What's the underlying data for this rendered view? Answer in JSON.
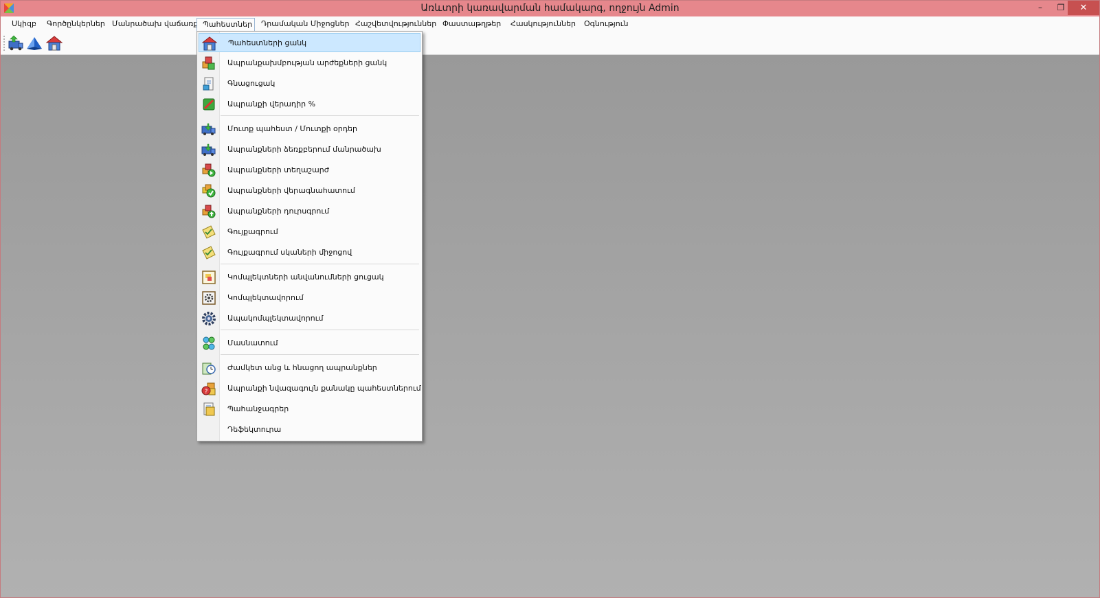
{
  "window": {
    "title": "Առևտրի կառավարման համակարգ, ողջույն Admin",
    "controls": {
      "minimize": "–",
      "restore": "❐",
      "close": "✕"
    }
  },
  "menubar": {
    "items": [
      "Սկիզբ",
      "Գործընկերներ",
      "Մանրածախ վաճառք",
      "Պահեստներ",
      "Դրամական Միջոցներ",
      "Հաշվետվություններ",
      "Փաստաթղթեր",
      "Հասկություններ",
      "Օգնություն"
    ],
    "active_index": 3
  },
  "toolbar": {
    "buttons": [
      "truck-upload-icon",
      "blue-pyramid-icon",
      "warehouse-house-icon"
    ]
  },
  "dropdown": {
    "items": [
      {
        "label": "Պահեստների ցանկ",
        "icon": "warehouse-house-icon",
        "highlighted": true
      },
      {
        "label": "Ապրանքախմբության արժեքների ցանկ",
        "icon": "product-boxes-icon"
      },
      {
        "label": "Գնացուցակ",
        "icon": "price-list-icon"
      },
      {
        "label": "Ապրանքի վերադիր %",
        "icon": "markup-percent-icon"
      },
      {
        "label": "Մուտք պահեստ / Մուտքի օրդեր",
        "icon": "truck-receive-icon"
      },
      {
        "label": "Ապրանքների ձեռքբերում մանրածախ",
        "icon": "truck-purchase-icon"
      },
      {
        "label": "Ապրանքների տեղաշարժ",
        "icon": "boxes-transfer-icon"
      },
      {
        "label": "Ապրանքների վերագնահատում",
        "icon": "boxes-revalue-icon"
      },
      {
        "label": "Ապրանքների դուրսգրում",
        "icon": "boxes-writeoff-icon"
      },
      {
        "label": "Գույքագրում",
        "icon": "inventory-notepad-icon"
      },
      {
        "label": "Գույքագրում սկաների միջոցով",
        "icon": "scanner-inventory-icon"
      },
      {
        "label": "Կոմպլեկտների անվանումների ցուցակ",
        "icon": "kit-names-list-icon"
      },
      {
        "label": "Կոմպլեկտավորում",
        "icon": "kit-assembly-icon"
      },
      {
        "label": "Ապակոմպլեկտավորում",
        "icon": "kit-disassembly-icon"
      },
      {
        "label": "Մասնատում",
        "icon": "split-circles-icon"
      },
      {
        "label": "Ժամկետ անց և հնացող ապրանքներ",
        "icon": "expired-goods-icon"
      },
      {
        "label": "Ապրանքի նվազագույն քանակը պահեստներում",
        "icon": "min-stock-icon"
      },
      {
        "label": "Պահանջագրեր",
        "icon": "requisitions-icon"
      },
      {
        "label": "Դեֆեկտուրա",
        "icon": ""
      }
    ]
  },
  "colors": {
    "titlebar": "#e6878c",
    "close_button": "#c75050",
    "highlight": "#cce8ff",
    "workspace": "#a6a6a6"
  }
}
